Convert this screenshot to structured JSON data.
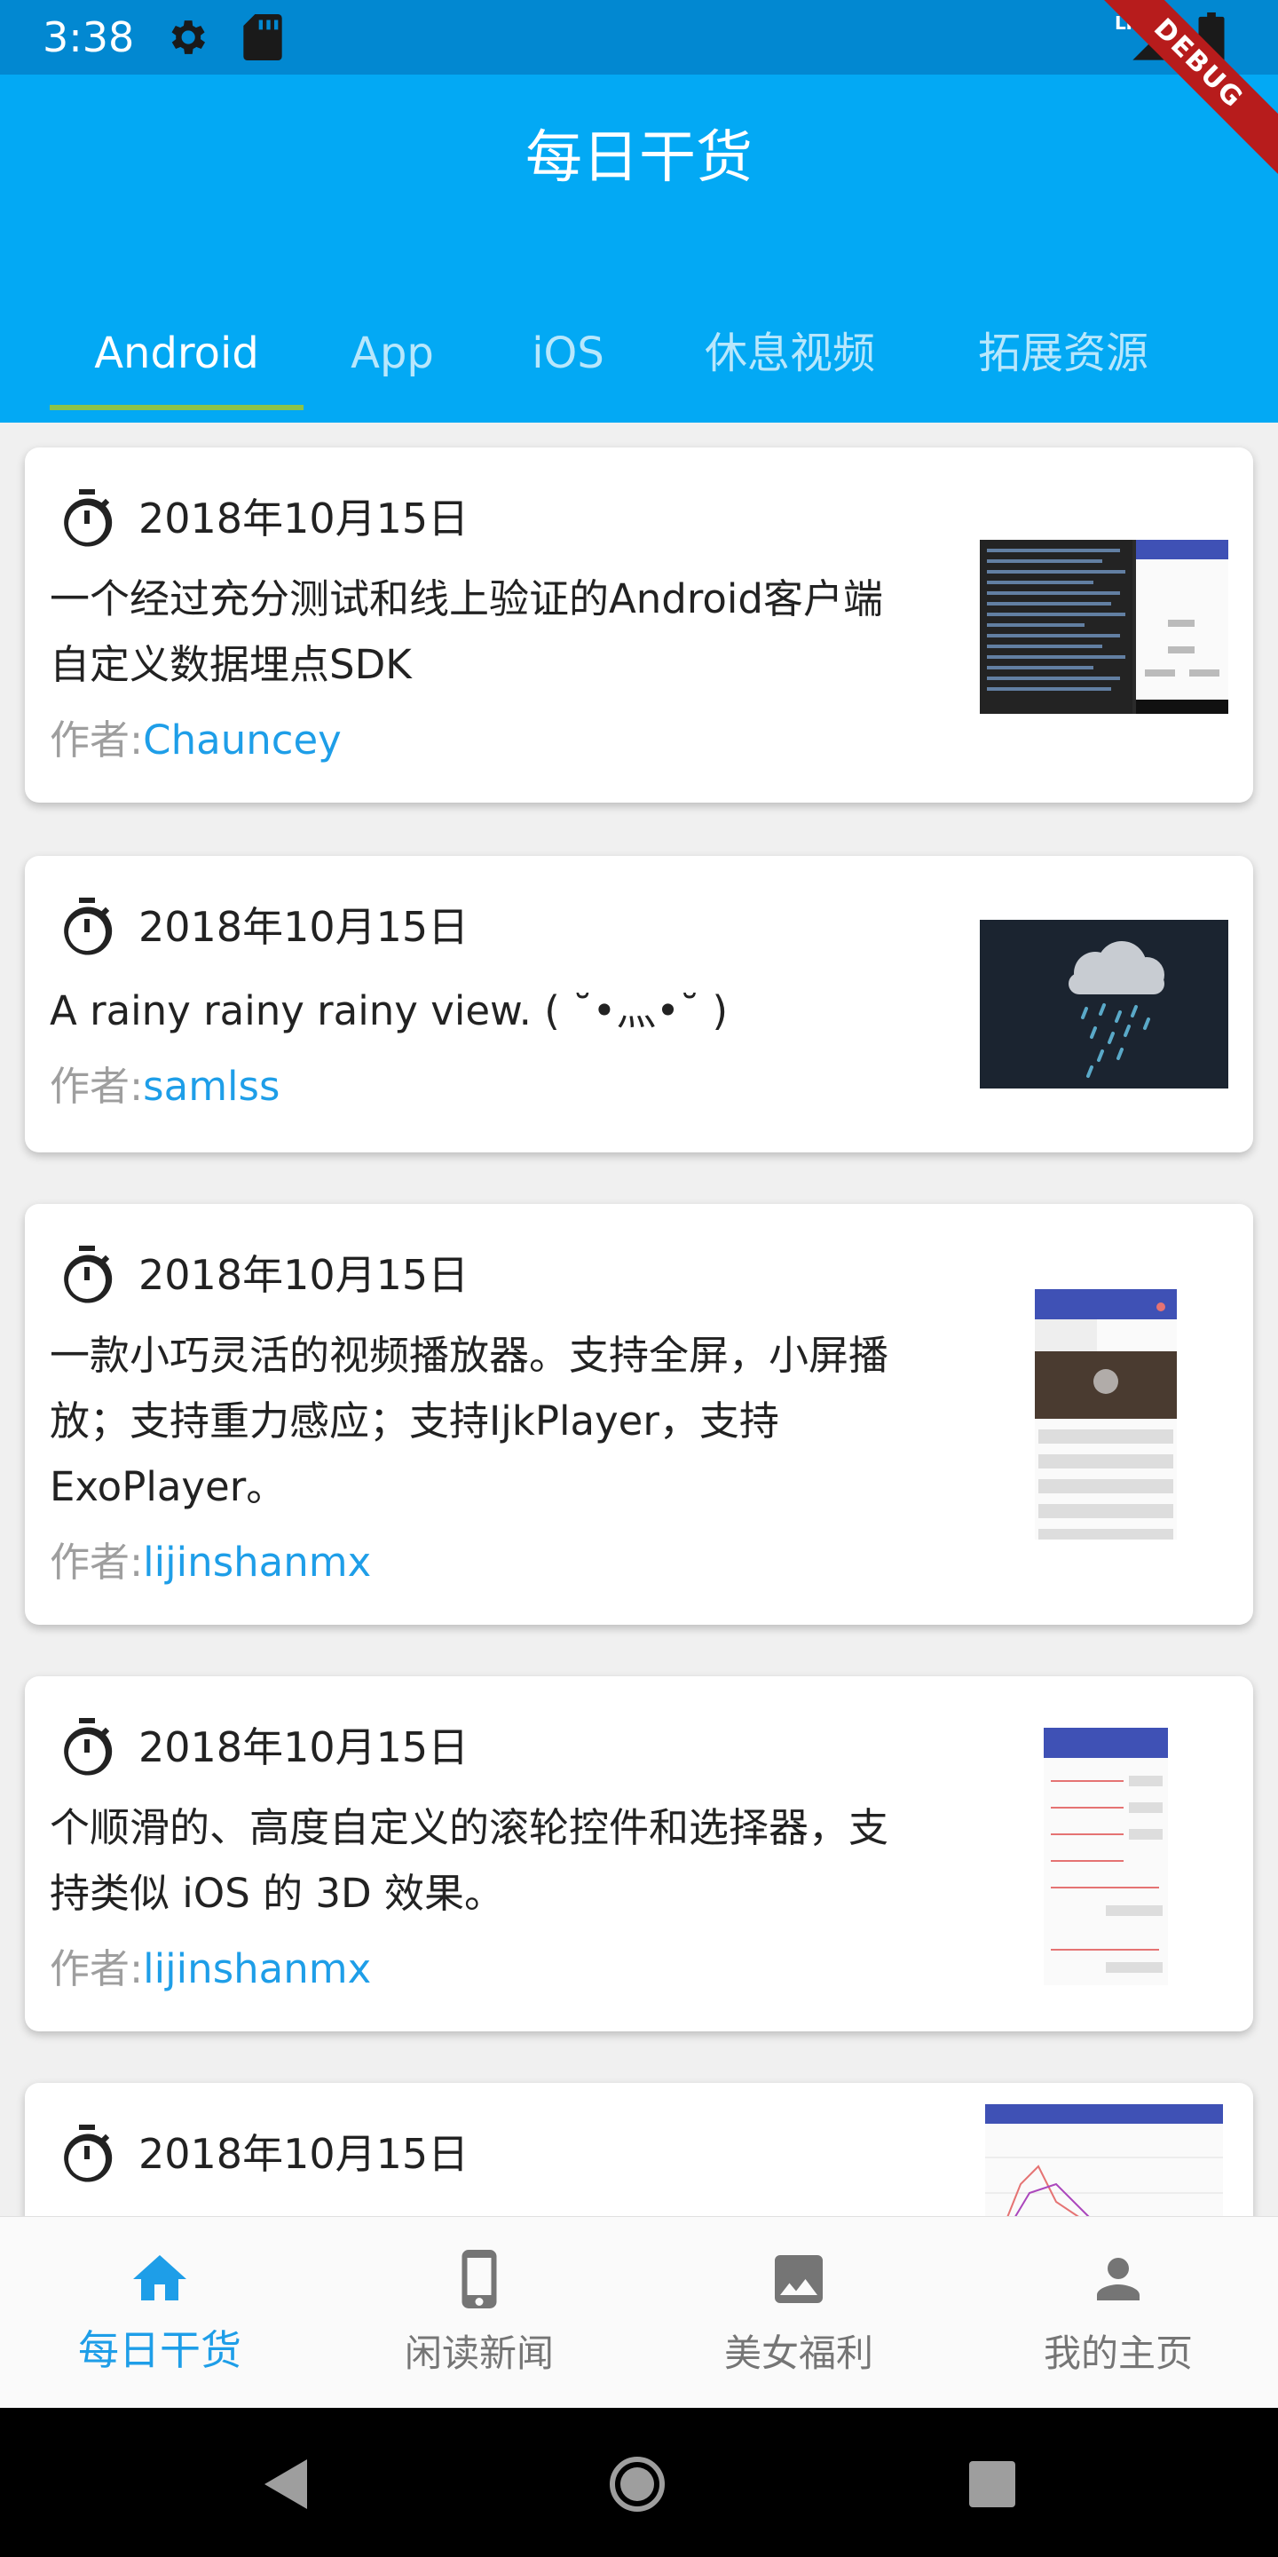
{
  "status_bar": {
    "time": "3:38",
    "network": "LTE",
    "debug_label": "DEBUG"
  },
  "app_bar": {
    "title": "每日干货"
  },
  "tabs": [
    {
      "label": "Android",
      "active": true
    },
    {
      "label": "App"
    },
    {
      "label": "iOS"
    },
    {
      "label": "休息视频"
    },
    {
      "label": "拓展资源"
    }
  ],
  "author_prefix": "作者:",
  "articles": [
    {
      "date": "2018年10月15日",
      "desc_lines": [
        "一个经过充分测试和线上验证的Android客户端",
        "自定义数据埋点SDK"
      ],
      "author": "Chauncey"
    },
    {
      "date": "2018年10月15日",
      "desc_lines": [
        "A rainy rainy rainy view. ( ˘•灬•˘ )"
      ],
      "author": "samlss"
    },
    {
      "date": "2018年10月15日",
      "desc_lines": [
        "一款小巧灵活的视频播放器。支持全屏，小屏播",
        "放；支持重力感应；支持IjkPlayer，支持",
        "ExoPlayer。"
      ],
      "author": "lijinshanmx"
    },
    {
      "date": "2018年10月15日",
      "desc_lines": [
        "个顺滑的、高度自定义的滚轮控件和选择器，支",
        "持类似 iOS 的 3D 效果。"
      ],
      "author": "lijinshanmx"
    },
    {
      "date": "2018年10月15日"
    }
  ],
  "bottom_nav": [
    {
      "label": "每日干货",
      "icon": "home-icon",
      "active": true
    },
    {
      "label": "闲读新闻",
      "icon": "phone-icon"
    },
    {
      "label": "美女福利",
      "icon": "image-icon"
    },
    {
      "label": "我的主页",
      "icon": "person-icon"
    }
  ],
  "colors": {
    "primary": "#03a9f4",
    "status_bar": "#0288d1",
    "accent": "#1e9ee8",
    "indicator": "#8bc34a"
  }
}
